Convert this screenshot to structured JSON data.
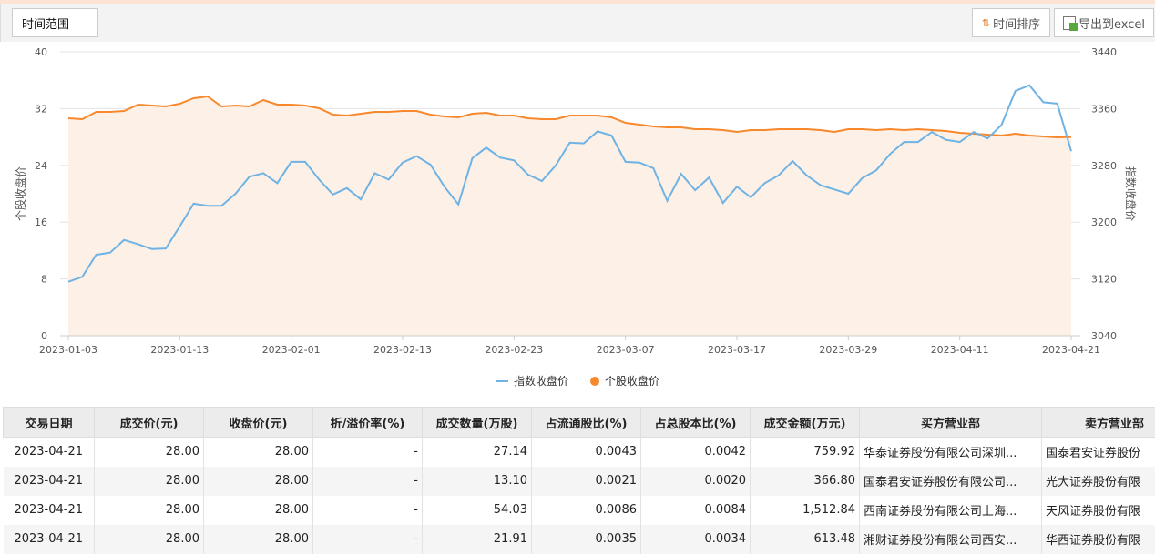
{
  "toolbar": {
    "time_range": "时间范围",
    "sort": "时间排序",
    "export": "导出到excel"
  },
  "chart_data": {
    "type": "line",
    "left_axis": {
      "label": "个股收盘价",
      "ticks": [
        0,
        8,
        16,
        24,
        32,
        40
      ],
      "ylim": [
        0,
        40
      ]
    },
    "right_axis": {
      "label": "指数收盘价",
      "ticks": [
        3040,
        3120,
        3200,
        3280,
        3360,
        3440
      ],
      "ylim": [
        3040,
        3440
      ]
    },
    "x_ticks": [
      "2023-01-03",
      "2023-01-13",
      "2023-02-01",
      "2023-02-13",
      "2023-02-23",
      "2023-03-07",
      "2023-03-17",
      "2023-03-29",
      "2023-04-11",
      "2023-04-21"
    ],
    "grid": true,
    "legend_position": "bottom-center",
    "colors": {
      "index": "#6eb3e4",
      "stock": "#f7882b",
      "area": "#fdf0e6"
    },
    "dates": [
      "2023-01-03",
      "2023-01-04",
      "2023-01-05",
      "2023-01-06",
      "2023-01-09",
      "2023-01-10",
      "2023-01-11",
      "2023-01-12",
      "2023-01-13",
      "2023-01-16",
      "2023-01-17",
      "2023-01-18",
      "2023-01-19",
      "2023-01-20",
      "2023-01-30",
      "2023-01-31",
      "2023-02-01",
      "2023-02-02",
      "2023-02-03",
      "2023-02-06",
      "2023-02-07",
      "2023-02-08",
      "2023-02-09",
      "2023-02-10",
      "2023-02-13",
      "2023-02-14",
      "2023-02-15",
      "2023-02-16",
      "2023-02-17",
      "2023-02-20",
      "2023-02-21",
      "2023-02-22",
      "2023-02-23",
      "2023-02-24",
      "2023-02-27",
      "2023-02-28",
      "2023-03-01",
      "2023-03-02",
      "2023-03-03",
      "2023-03-06",
      "2023-03-07",
      "2023-03-08",
      "2023-03-09",
      "2023-03-10",
      "2023-03-13",
      "2023-03-14",
      "2023-03-15",
      "2023-03-16",
      "2023-03-17",
      "2023-03-20",
      "2023-03-21",
      "2023-03-22",
      "2023-03-23",
      "2023-03-24",
      "2023-03-27",
      "2023-03-28",
      "2023-03-29",
      "2023-03-30",
      "2023-03-31",
      "2023-04-03",
      "2023-04-04",
      "2023-04-06",
      "2023-04-07",
      "2023-04-10",
      "2023-04-11",
      "2023-04-12",
      "2023-04-13",
      "2023-04-14",
      "2023-04-17",
      "2023-04-18",
      "2023-04-19",
      "2023-04-20",
      "2023-04-21"
    ],
    "series": [
      {
        "name": "指数收盘价",
        "axis": "right",
        "style": "line",
        "values": [
          3116,
          3123,
          3154,
          3157,
          3175,
          3169,
          3162,
          3163,
          3194,
          3226,
          3223,
          3223,
          3240,
          3264,
          3269,
          3255,
          3285,
          3285,
          3260,
          3239,
          3248,
          3232,
          3269,
          3260,
          3284,
          3293,
          3281,
          3250,
          3225,
          3290,
          3305,
          3291,
          3287,
          3267,
          3258,
          3280,
          3312,
          3311,
          3328,
          3322,
          3285,
          3284,
          3276,
          3230,
          3268,
          3245,
          3263,
          3227,
          3250,
          3235,
          3255,
          3266,
          3286,
          3266,
          3252,
          3246,
          3240,
          3262,
          3273,
          3296,
          3313,
          3313,
          3327,
          3316,
          3313,
          3327,
          3318,
          3337,
          3385,
          3393,
          3369,
          3367,
          3300
        ]
      },
      {
        "name": "个股收盘价",
        "axis": "left",
        "style": "area",
        "values": [
          30.64,
          30.51,
          31.54,
          31.54,
          31.67,
          32.56,
          32.44,
          32.31,
          32.69,
          33.46,
          33.72,
          32.31,
          32.44,
          32.31,
          33.21,
          32.56,
          32.56,
          32.44,
          32.05,
          31.15,
          31.03,
          31.28,
          31.54,
          31.54,
          31.67,
          31.67,
          31.15,
          30.9,
          30.77,
          31.28,
          31.41,
          31.03,
          31.03,
          30.64,
          30.51,
          30.51,
          31.03,
          31.03,
          31.03,
          30.77,
          30.0,
          29.74,
          29.49,
          29.36,
          29.36,
          29.1,
          29.1,
          28.97,
          28.72,
          28.97,
          28.97,
          29.1,
          29.1,
          29.1,
          28.97,
          28.72,
          29.1,
          29.1,
          28.97,
          29.1,
          28.97,
          29.1,
          28.97,
          28.85,
          28.59,
          28.46,
          28.33,
          28.21,
          28.46,
          28.21,
          28.08,
          27.95,
          28.0
        ]
      }
    ]
  },
  "table": {
    "headers": [
      "交易日期",
      "成交价(元)",
      "收盘价(元)",
      "折/溢价率(%)",
      "成交数量(万股)",
      "占流通股比(%)",
      "占总股本比(%)",
      "成交金额(万元)",
      "买方营业部",
      "卖方营业部"
    ],
    "rows": [
      [
        "2023-04-21",
        "28.00",
        "28.00",
        "-",
        "27.14",
        "0.0043",
        "0.0042",
        "759.92",
        "华泰证券股份有限公司深圳...",
        "国泰君安证券股份"
      ],
      [
        "2023-04-21",
        "28.00",
        "28.00",
        "-",
        "13.10",
        "0.0021",
        "0.0020",
        "366.80",
        "国泰君安证券股份有限公司...",
        "光大证券股份有限"
      ],
      [
        "2023-04-21",
        "28.00",
        "28.00",
        "-",
        "54.03",
        "0.0086",
        "0.0084",
        "1,512.84",
        "西南证券股份有限公司上海...",
        "天风证券股份有限"
      ],
      [
        "2023-04-21",
        "28.00",
        "28.00",
        "-",
        "21.91",
        "0.0035",
        "0.0034",
        "613.48",
        "湘财证券股份有限公司西安...",
        "华西证券股份有限"
      ]
    ]
  }
}
